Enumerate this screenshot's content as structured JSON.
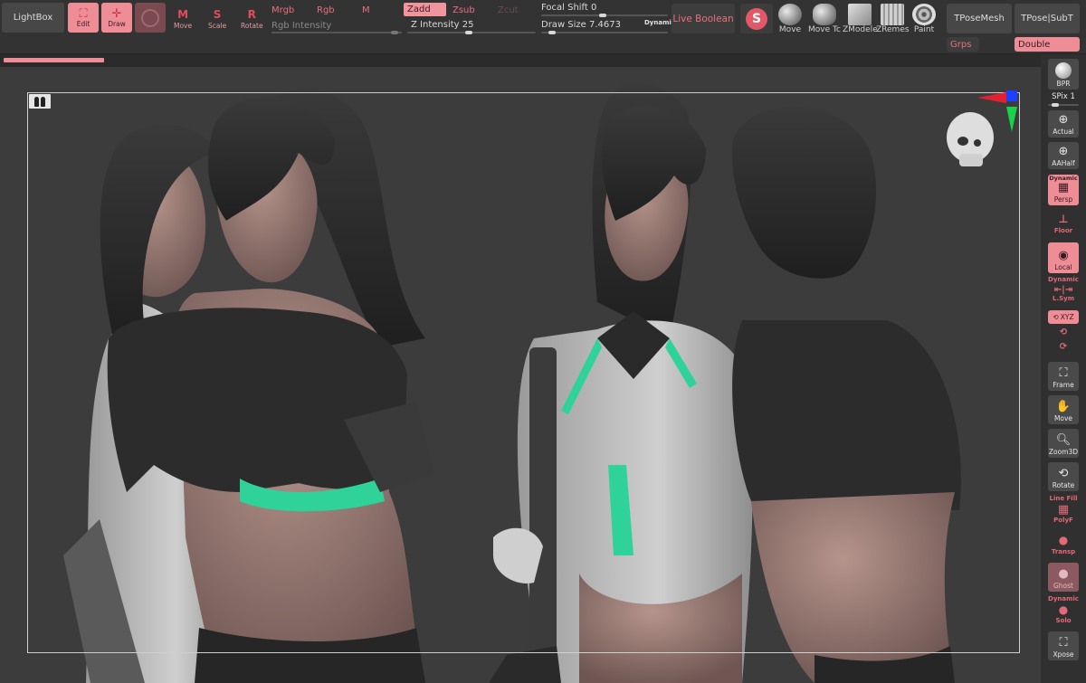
{
  "toolbar": {
    "lightbox_label": "LightBox",
    "edit_label": "Edit",
    "draw_label": "Draw",
    "move_label": "Move",
    "scale_label": "Scale",
    "rotate_label": "Rotate",
    "mrgb_label": "Mrgb",
    "rgb_label": "Rgb",
    "m_label": "M",
    "rgb_intensity_label": "Rgb Intensity",
    "zadd_label": "Zadd",
    "zsub_label": "Zsub",
    "zcut_label": "Zcut",
    "z_intensity_label": "Z Intensity 25",
    "focal_shift_label": "Focal Shift 0",
    "draw_size_label": "Draw Size 7.4673",
    "dynamic_label": "Dynamic",
    "live_boolean_label": "Live Boolean",
    "brushes": [
      {
        "label": "Move"
      },
      {
        "label": "Move Tc"
      },
      {
        "label": "ZModele"
      },
      {
        "label": "ZRemes"
      },
      {
        "label": "Paint"
      }
    ],
    "tpose_mesh_label": "TPoseMesh",
    "tpose_subt_label": "TPose|SubT",
    "grps_label": "Grps",
    "double_label": "Double"
  },
  "shelf": {
    "bpr_label": "BPR",
    "spix_label": "SPix 1",
    "actual_label": "Actual",
    "aahalf_label": "AAHalf",
    "persp_dynamic_label": "Dynamic",
    "persp_label": "Persp",
    "floor_label": "Floor",
    "local_label": "Local",
    "lsym_dynamic_label": "Dynamic",
    "lsym_label": "L.Sym",
    "xyz_label": "XYZ",
    "frame_label": "Frame",
    "move_label": "Move",
    "zoom3d_label": "Zoom3D",
    "rotate_label": "Rotate",
    "linefill_label": "Line Fill",
    "polyf_label": "PolyF",
    "transp_label": "Transp",
    "ghost_label": "Ghost",
    "solo_dynamic_label": "Dynamic",
    "solo_label": "Solo",
    "xpose_label": "Xpose"
  },
  "colors": {
    "accent": "#ef8d97",
    "accent_text": "#e8707c",
    "canvas": "#3c3c3c",
    "toolbar": "#333333",
    "skin": "#9b7d77",
    "shirt": "#2a2a2a",
    "jacket": "#c9c9c9",
    "trim": "#2fd39a"
  }
}
